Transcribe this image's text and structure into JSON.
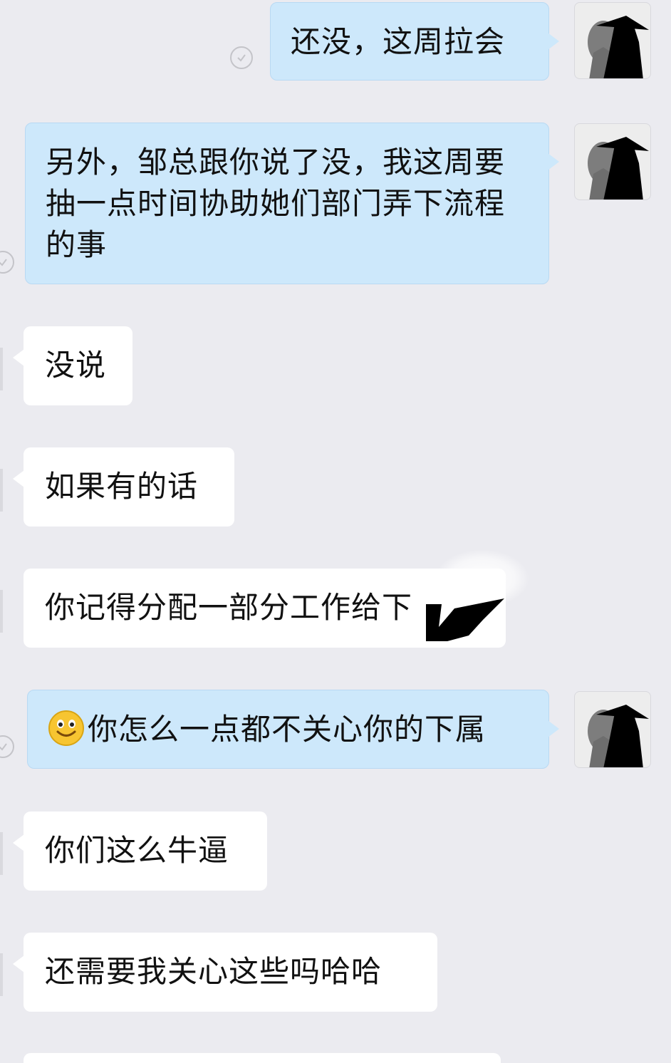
{
  "messages": [
    {
      "side": "out",
      "text": "还没，这周拉会"
    },
    {
      "side": "out",
      "text": "另外，邹总跟你说了没，我这周要抽一点时间协助她们部门弄下流程的事"
    },
    {
      "side": "in",
      "text": "没说"
    },
    {
      "side": "in",
      "text": "如果有的话"
    },
    {
      "side": "in",
      "text": "你记得分配一部分工作给下"
    },
    {
      "side": "out",
      "emoji": "smiley-emoji",
      "text": "你怎么一点都不关心你的下属"
    },
    {
      "side": "in",
      "text": "你们这么牛逼"
    },
    {
      "side": "in",
      "text": "还需要我关心这些吗哈哈"
    }
  ],
  "icons": {
    "avatar": "silhouette-avatar-icon",
    "read_receipt": "check-circle-icon",
    "emoji": "smiley-emoji"
  },
  "colors": {
    "background": "#ebebf0",
    "outgoing_bubble": "#cde8fb",
    "incoming_bubble": "#ffffff"
  }
}
